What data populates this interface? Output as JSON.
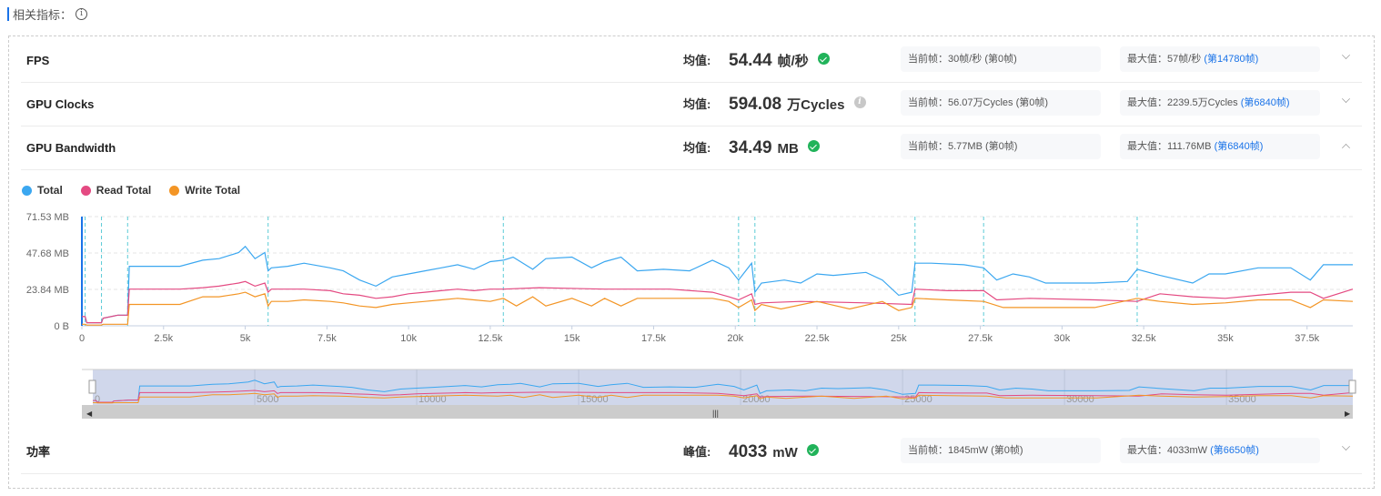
{
  "header": {
    "title": "相关指标：",
    "info_icon": "info-icon"
  },
  "metrics": [
    {
      "name": "FPS",
      "avg_label": "均值:",
      "avg_value": "54.44",
      "avg_unit": "帧/秒",
      "status": "ok",
      "current_label": "当前帧：",
      "current_value": "30帧/秒 (第0帧)",
      "max_label": "最大值：",
      "max_value": "57帧/秒 ",
      "max_link": "(第14780帧)",
      "expanded": false
    },
    {
      "name": "GPU Clocks",
      "avg_label": "均值:",
      "avg_value": "594.08",
      "avg_unit": "万Cycles",
      "status": "neutral",
      "current_label": "当前帧：",
      "current_value": "56.07万Cycles (第0帧)",
      "max_label": "最大值：",
      "max_value": "2239.5万Cycles ",
      "max_link": "(第6840帧)",
      "expanded": false
    },
    {
      "name": "GPU Bandwidth",
      "avg_label": "均值:",
      "avg_value": "34.49",
      "avg_unit": "MB",
      "status": "ok",
      "current_label": "当前帧：",
      "current_value": "5.77MB (第0帧)",
      "max_label": "最大值：",
      "max_value": "111.76MB ",
      "max_link": "(第6840帧)",
      "expanded": true
    },
    {
      "name": "功率",
      "avg_label": "峰值:",
      "avg_value": "4033",
      "avg_unit": "mW",
      "status": "ok",
      "current_label": "当前帧：",
      "current_value": "1845mW (第0帧)",
      "max_label": "最大值：",
      "max_value": "4033mW ",
      "max_link": "(第6650帧)",
      "expanded": false
    }
  ],
  "colors": {
    "total": "#3ba7f0",
    "read": "#e44a82",
    "write": "#f39525",
    "accent": "#1a73e8",
    "marker": "#5bcbd6"
  },
  "chart_data": {
    "type": "line",
    "title": "",
    "legend": [
      "Total",
      "Read Total",
      "Write Total"
    ],
    "legend_position": "top-left",
    "ylabel": "",
    "xlabel": "",
    "ylim": [
      0,
      71.53
    ],
    "yticks": [
      0,
      23.84,
      47.68,
      71.53
    ],
    "ytick_labels": [
      "0 B",
      "23.84 MB",
      "47.68 MB",
      "71.53 MB"
    ],
    "xlim": [
      0,
      38900
    ],
    "xticks": [
      0,
      2500,
      5000,
      7500,
      10000,
      12500,
      15000,
      17500,
      20000,
      22500,
      25000,
      27500,
      30000,
      32500,
      35000,
      37500
    ],
    "xtick_labels": [
      "0",
      "2.5k",
      "5k",
      "7.5k",
      "10k",
      "12.5k",
      "15k",
      "17.5k",
      "20k",
      "22.5k",
      "25k",
      "27.5k",
      "30k",
      "32.5k",
      "35k",
      "37.5k"
    ],
    "grid": true,
    "markers_x": [
      100,
      600,
      1400,
      5700,
      12900,
      20100,
      20600,
      25500,
      27600,
      32300
    ],
    "series": [
      {
        "name": "Total",
        "x": [
          0,
          100,
          150,
          600,
          650,
          1100,
          1400,
          1450,
          3000,
          3700,
          4200,
          4800,
          5000,
          5300,
          5600,
          5700,
          5800,
          6300,
          6800,
          7600,
          8000,
          8500,
          9000,
          9500,
          10000,
          10500,
          11000,
          11500,
          12000,
          12500,
          12900,
          13200,
          13800,
          14200,
          15000,
          15600,
          16000,
          16500,
          17000,
          17800,
          18600,
          19300,
          19800,
          20100,
          20500,
          20600,
          20800,
          21500,
          22000,
          22500,
          23000,
          24000,
          24500,
          25000,
          25400,
          25500,
          26000,
          27000,
          27600,
          28000,
          28500,
          29000,
          29500,
          31000,
          32000,
          32300,
          33000,
          34000,
          34500,
          35000,
          36000,
          37000,
          37600,
          38000,
          38900
        ],
        "values": [
          6,
          6,
          2,
          2,
          5,
          7,
          7,
          39,
          39,
          43,
          44,
          48,
          52,
          44,
          48,
          36,
          38,
          39,
          41,
          38,
          36,
          30,
          26,
          32,
          34,
          36,
          38,
          40,
          37,
          42,
          43,
          45,
          37,
          44,
          45,
          38,
          42,
          45,
          36,
          37,
          36,
          43,
          38,
          30,
          41,
          22,
          28,
          30,
          28,
          34,
          33,
          35,
          30,
          20,
          22,
          41,
          41,
          40,
          38,
          30,
          34,
          32,
          28,
          28,
          29,
          37,
          33,
          28,
          34,
          34,
          38,
          38,
          30,
          40,
          40
        ]
      },
      {
        "name": "Read Total",
        "x": [
          0,
          100,
          150,
          600,
          650,
          1100,
          1400,
          1450,
          3000,
          3700,
          4200,
          4800,
          5000,
          5300,
          5600,
          5700,
          5800,
          6300,
          6800,
          7600,
          8000,
          8500,
          9000,
          9500,
          10000,
          10500,
          11000,
          11500,
          12000,
          12500,
          12900,
          14000,
          16000,
          18000,
          19300,
          19800,
          20100,
          20500,
          20600,
          20800,
          22000,
          24000,
          25400,
          25500,
          26500,
          27600,
          28000,
          29000,
          31000,
          32300,
          33000,
          34000,
          35000,
          36000,
          37000,
          37600,
          38000,
          38900
        ],
        "values": [
          6,
          6,
          2,
          2,
          5,
          7,
          7,
          24,
          24,
          25,
          26,
          28,
          29,
          26,
          28,
          22,
          24,
          24,
          24,
          23,
          21,
          20,
          18,
          19,
          21,
          22,
          23,
          24,
          23,
          24,
          24,
          25,
          24,
          24,
          22,
          19,
          17,
          21,
          14,
          15,
          16,
          15,
          14,
          24,
          23,
          23,
          17,
          18,
          17,
          16,
          21,
          19,
          18,
          20,
          22,
          22,
          18,
          24
        ]
      },
      {
        "name": "Write Total",
        "x": [
          0,
          100,
          150,
          600,
          650,
          1100,
          1400,
          1450,
          3000,
          3700,
          4200,
          4800,
          5000,
          5300,
          5600,
          5700,
          5800,
          6300,
          6800,
          7600,
          8000,
          8500,
          9000,
          9500,
          10000,
          10500,
          11000,
          11500,
          12000,
          12500,
          12900,
          13300,
          13800,
          14200,
          15000,
          15600,
          16000,
          16500,
          17000,
          18500,
          19300,
          19800,
          20100,
          20500,
          20600,
          20800,
          21400,
          22500,
          23500,
          24500,
          25000,
          25400,
          25500,
          26500,
          27600,
          28200,
          29500,
          31000,
          32300,
          33000,
          34000,
          35000,
          36000,
          37000,
          37600,
          38000,
          38900
        ],
        "values": [
          1,
          1,
          0.5,
          0.5,
          1,
          1,
          1,
          14,
          14,
          19,
          19,
          21,
          22,
          19,
          21,
          13,
          16,
          16,
          17,
          16,
          15,
          13,
          12,
          14,
          15,
          16,
          17,
          18,
          17,
          16,
          18,
          13,
          19,
          13,
          18,
          13,
          18,
          13,
          18,
          18,
          18,
          16,
          12,
          17,
          10,
          14,
          11,
          16,
          11,
          16,
          10,
          12,
          18,
          17,
          16,
          12,
          12,
          12,
          18,
          16,
          14,
          15,
          17,
          17,
          12,
          17,
          16
        ]
      }
    ],
    "datazoom": {
      "start": 0,
      "end": 100,
      "axis_labels": [
        "0",
        "5000",
        "10000",
        "15000",
        "20000",
        "25000",
        "30000",
        "35000"
      ]
    }
  }
}
